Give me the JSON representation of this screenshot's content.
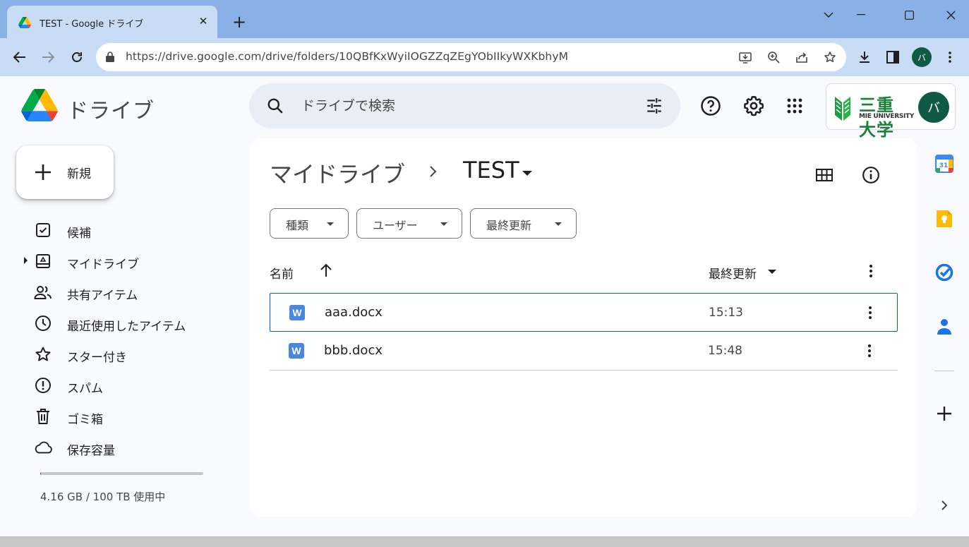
{
  "browser": {
    "tab_title": "TEST - Google ドライブ",
    "tab_close": "✕",
    "new_tab": "+",
    "url": "https://drive.google.com/drive/folders/10QBfKxWyiIOGZZqZEgYObIIkyWXKbhyM",
    "profile_initial": "バ"
  },
  "drive": {
    "product_name": "ドライブ",
    "search_placeholder": "ドライブで検索",
    "new_button": "新規",
    "account": {
      "org_name": "三重大学",
      "org_sub": "MIE UNIVERSITY",
      "avatar_initial": "バ"
    },
    "nav": [
      {
        "label": "候補",
        "icon": "suggested-icon"
      },
      {
        "label": "マイドライブ",
        "icon": "my-drive-icon"
      },
      {
        "label": "共有アイテム",
        "icon": "shared-icon"
      },
      {
        "label": "最近使用したアイテム",
        "icon": "recent-icon"
      },
      {
        "label": "スター付き",
        "icon": "star-icon"
      },
      {
        "label": "スパム",
        "icon": "spam-icon"
      },
      {
        "label": "ゴミ箱",
        "icon": "trash-icon"
      },
      {
        "label": "保存容量",
        "icon": "cloud-icon"
      }
    ],
    "storage": {
      "text": "4.16 GB / 100 TB 使用中",
      "used_fraction": 0.004
    },
    "breadcrumb": {
      "root": "マイドライブ",
      "current": "TEST"
    },
    "filters": [
      "種類",
      "ユーザー",
      "最終更新"
    ],
    "columns": {
      "name": "名前",
      "modified": "最終更新"
    },
    "files": [
      {
        "name": "aaa.docx",
        "modified": "15:13",
        "type_letter": "W"
      },
      {
        "name": "bbb.docx",
        "modified": "15:48",
        "type_letter": "W"
      }
    ],
    "side_apps": [
      "calendar-icon",
      "keep-icon",
      "tasks-icon",
      "contacts-icon",
      "add-icon"
    ],
    "calendar_day": "31"
  },
  "colors": {
    "accent": "#0b57d0",
    "titlebar": "#8ab1e6",
    "toolbar": "#c9dcf5",
    "avatar": "#0f5a44"
  }
}
